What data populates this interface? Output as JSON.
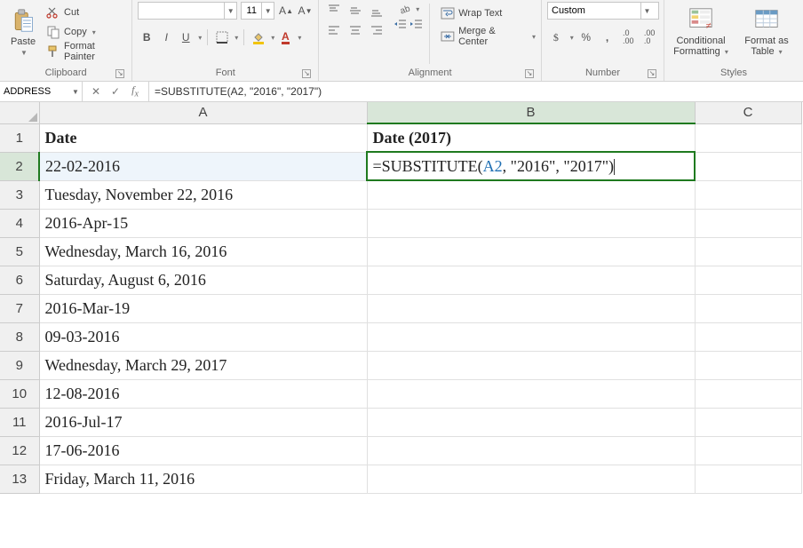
{
  "ribbon": {
    "clipboard": {
      "paste": "Paste",
      "cut": "Cut",
      "copy": "Copy",
      "format_painter": "Format Painter",
      "label": "Clipboard"
    },
    "font": {
      "name_placeholder": "",
      "size": "11",
      "bold": "B",
      "italic": "I",
      "underline": "U",
      "label": "Font"
    },
    "alignment": {
      "wrap": "Wrap Text",
      "merge": "Merge & Center",
      "label": "Alignment"
    },
    "number": {
      "format": "Custom",
      "increase_decimal_tip": ".0 .00",
      "label": "Number"
    },
    "styles": {
      "conditional": "Conditional Formatting",
      "table": "Format as Table",
      "label": "Styles"
    }
  },
  "formula_bar": {
    "namebox": "ADDRESS",
    "formula": "=SUBSTITUTE(A2, \"2016\", \"2017\")"
  },
  "chart_data": {
    "type": "table",
    "columns": [
      "A",
      "B",
      "C"
    ],
    "header_row": [
      "Date",
      "Date (2017)",
      ""
    ],
    "rows": [
      [
        "22-02-2016",
        "=SUBSTITUTE(A2, \"2016\", \"2017\")",
        ""
      ],
      [
        "Tuesday, November 22, 2016",
        "",
        ""
      ],
      [
        "2016-Apr-15",
        "",
        ""
      ],
      [
        "Wednesday, March 16, 2016",
        "",
        ""
      ],
      [
        "Saturday, August 6, 2016",
        "",
        ""
      ],
      [
        "2016-Mar-19",
        "",
        ""
      ],
      [
        "09-03-2016",
        "",
        ""
      ],
      [
        "Wednesday, March 29, 2017",
        "",
        ""
      ],
      [
        "12-08-2016",
        "",
        ""
      ],
      [
        "2016-Jul-17",
        "",
        ""
      ],
      [
        "17-06-2016",
        "",
        ""
      ],
      [
        "Friday, March 11, 2016",
        "",
        ""
      ]
    ],
    "active_cell": "B2",
    "editing_formula_parts": {
      "prefix": "=SUBSTITUTE(",
      "ref": "A2",
      "suffix": ", \"2016\", \"2017\")"
    }
  }
}
